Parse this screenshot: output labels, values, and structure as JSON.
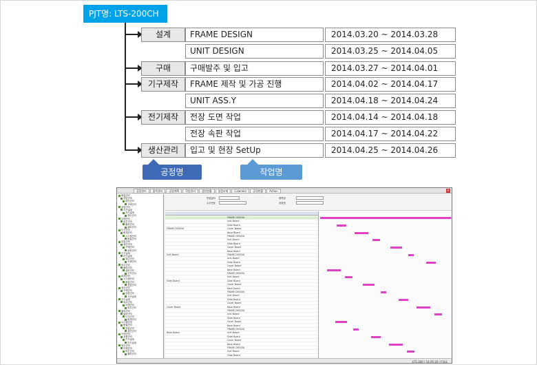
{
  "project": {
    "title": "PJT명: LTS-200CH"
  },
  "rows": [
    {
      "process": "설계",
      "task": "FRAME DESIGN",
      "dates": "2014.03.20 ~ 2014.03.28"
    },
    {
      "process": "",
      "task": "UNIT DESIGN",
      "dates": "2014.03.25 ~ 2014.04.05"
    },
    {
      "process": "구매",
      "task": "구매발주 및 입고",
      "dates": "2014.03.27 ~ 2014.04.01"
    },
    {
      "process": "기구제작",
      "task": "FRAME 제작 및 가공 진행",
      "dates": "2014.04.02 ~ 2014.04.17"
    },
    {
      "process": "",
      "task": "UNIT ASS.Y",
      "dates": "2014.04.18 ~ 2014.04.24"
    },
    {
      "process": "전기제작",
      "task": "전장 도면 작업",
      "dates": "2014.04.14 ~ 2014.04.18"
    },
    {
      "process": "",
      "task": "전장 속판 작업",
      "dates": "2014.04.17 ~ 2014.04.22"
    },
    {
      "process": "생산관리",
      "task": "입고 및 현장 SetUp",
      "dates": "2014.04.25 ~ 2014.04.26"
    }
  ],
  "labels": {
    "process_name": "공정명",
    "task_name": "작업명"
  },
  "screenshot": {
    "tabs": [
      "공정관리",
      "품목관리",
      "공정계획",
      "작업관리",
      "생산현황",
      "일정조회",
      "Calendar",
      "공정현황",
      "Action"
    ],
    "sidebar_items": [
      "품질관리",
      "영업관리",
      "생산관리",
      "구매관리",
      "공정관리",
      "기구설계",
      "전기설계",
      "재고관리",
      "자재관리",
      "외주관리",
      "출하관리",
      "설비관리",
      "인사관리",
      "회계관리",
      "시스템관리"
    ],
    "bottom_tabs": [
      "Menu",
      "Favorite",
      "History"
    ],
    "filter_labels": [
      "작업일자",
      "수주번호",
      "품목명",
      "공정명"
    ],
    "grid_texts": [
      "FRAME DESIGN",
      "Unit Board",
      "Slide Board",
      "Cover Board",
      "Base Board"
    ],
    "status_text": "LTS-200 | 14.05.20 | FULL"
  }
}
